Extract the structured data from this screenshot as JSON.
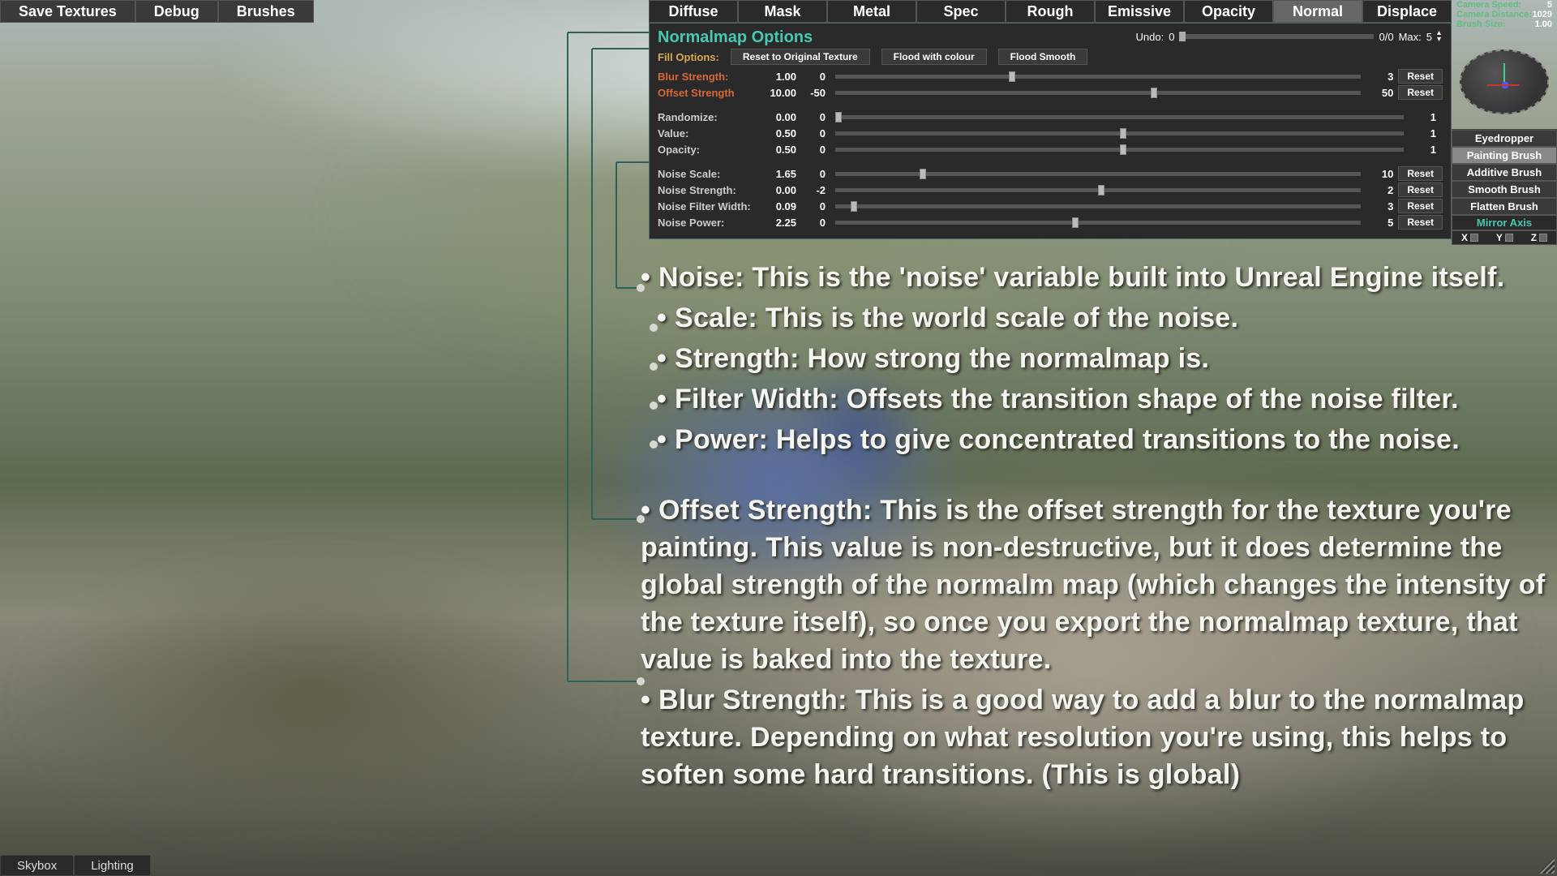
{
  "top_menu": {
    "save": "Save Textures",
    "debug": "Debug",
    "brushes": "Brushes"
  },
  "bottom_menu": {
    "skybox": "Skybox",
    "lighting": "Lighting"
  },
  "tabs": [
    "Diffuse",
    "Mask",
    "Metal",
    "Spec",
    "Rough",
    "Emissive",
    "Opacity",
    "Normal",
    "Displace"
  ],
  "active_tab": "Normal",
  "panel_title": "Normalmap Options",
  "undo": {
    "label": "Undo:",
    "value": "0",
    "count": "0/0",
    "max_label": "Max:",
    "max": "5"
  },
  "fill": {
    "label": "Fill Options:",
    "buttons": [
      "Reset to Original Texture",
      "Flood with colour",
      "Flood Smooth"
    ]
  },
  "options": [
    {
      "label": "Blur Strength:",
      "val": "1.00",
      "min": "0",
      "max": "3",
      "pct": 33,
      "reset": true,
      "orange": true
    },
    {
      "label": "Offset Strength",
      "val": "10.00",
      "min": "-50",
      "max": "50",
      "pct": 60,
      "reset": true,
      "orange": true
    }
  ],
  "options2": [
    {
      "label": "Randomize:",
      "val": "0.00",
      "min": "0",
      "max": "1",
      "pct": 0
    },
    {
      "label": "Value:",
      "val": "0.50",
      "min": "0",
      "max": "1",
      "pct": 50
    },
    {
      "label": "Opacity:",
      "val": "0.50",
      "min": "0",
      "max": "1",
      "pct": 50
    }
  ],
  "swatch_color": "#b8b8b8",
  "options3": [
    {
      "label": "Noise Scale:",
      "val": "1.65",
      "min": "0",
      "max": "10",
      "pct": 16,
      "reset": true
    },
    {
      "label": "Noise Strength:",
      "val": "0.00",
      "min": "-2",
      "max": "2",
      "pct": 50,
      "reset": true
    },
    {
      "label": "Noise Filter Width:",
      "val": "0.09",
      "min": "0",
      "max": "3",
      "pct": 3,
      "reset": true
    },
    {
      "label": "Noise Power:",
      "val": "2.25",
      "min": "0",
      "max": "5",
      "pct": 45,
      "reset": true
    }
  ],
  "reset_label": "Reset",
  "cam": {
    "speed_label": "Camera Speed:",
    "speed": "5",
    "dist_label": "Camera Distance:",
    "dist": "1029",
    "brush_label": "Brush Size:",
    "brush": "1.00"
  },
  "brushes": {
    "list": [
      "Eyedropper",
      "Painting Brush",
      "Additive Brush",
      "Smooth Brush",
      "Flatten Brush"
    ],
    "active": "Painting Brush",
    "mirror_label": "Mirror Axis",
    "axes": [
      "X",
      "Y",
      "Z"
    ]
  },
  "notes": {
    "noise": "Noise: This is the 'noise' variable built into Unreal Engine itself.",
    "scale": "Scale: This is the world scale of the noise.",
    "strength": "Strength: How strong the normalmap is.",
    "filter": "Filter Width: Offsets the transition shape of the noise filter.",
    "power": "Power: Helps to give concentrated transitions to the noise.",
    "offset": "Offset Strength: This is the offset strength for the texture you're painting. This value is non-destructive, but it does determine the global strength of the normalm map (which changes the intensity of the texture itself), so once you export the normalmap texture, that value is baked into the texture.",
    "blur": "Blur Strength: This is a good way to add a blur to the normalmap texture. Depending on what resolution you're using, this helps to soften some hard transitions. (This is global)"
  },
  "bullet": "•"
}
